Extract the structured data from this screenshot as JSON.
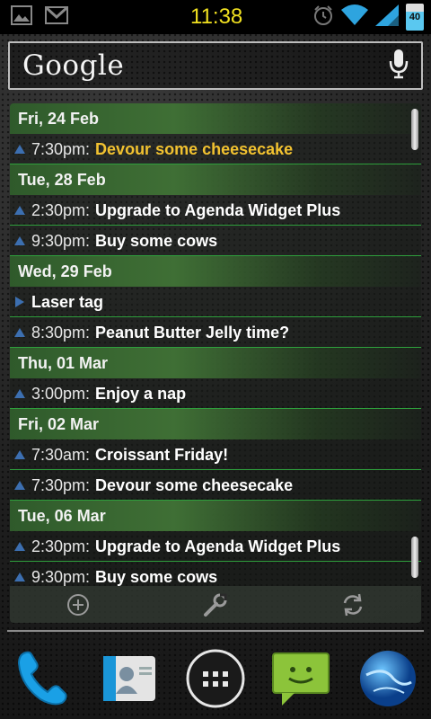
{
  "status_bar": {
    "time": "11:38",
    "battery_level": "40",
    "left_icons": [
      "gallery-icon",
      "gmail-icon"
    ],
    "right_icons": [
      "alarm-icon",
      "wifi-icon",
      "signal-icon",
      "battery-icon"
    ]
  },
  "search": {
    "logo": "Google",
    "mic_icon": "microphone-icon"
  },
  "agenda": {
    "days": [
      {
        "label": "Fri, 24 Feb",
        "events": [
          {
            "time": "7:30pm:",
            "title": "Devour some cheesecake",
            "highlight": true
          }
        ]
      },
      {
        "label": "Tue, 28 Feb",
        "events": [
          {
            "time": "2:30pm:",
            "title": "Upgrade to Agenda Widget Plus"
          },
          {
            "time": "9:30pm:",
            "title": "Buy some cows"
          }
        ]
      },
      {
        "label": "Wed, 29 Feb",
        "events": [
          {
            "time": "",
            "title": "Laser tag",
            "all_day": true
          },
          {
            "time": "8:30pm:",
            "title": "Peanut Butter Jelly time?"
          }
        ]
      },
      {
        "label": "Thu, 01 Mar",
        "events": [
          {
            "time": "3:00pm:",
            "title": "Enjoy a nap"
          }
        ]
      },
      {
        "label": "Fri, 02 Mar",
        "events": [
          {
            "time": "7:30am:",
            "title": "Croissant Friday!"
          },
          {
            "time": "7:30pm:",
            "title": "Devour some cheesecake"
          }
        ]
      },
      {
        "label": "Tue, 06 Mar",
        "events": [
          {
            "time": "2:30pm:",
            "title": "Upgrade to Agenda Widget Plus"
          },
          {
            "time": "9:30pm:",
            "title": "Buy some cows"
          }
        ]
      }
    ],
    "toolbar": [
      "add-icon",
      "settings-wrench-icon",
      "refresh-icon"
    ]
  },
  "dock": [
    "phone-icon",
    "contacts-icon",
    "app-drawer-icon",
    "messaging-icon",
    "browser-icon"
  ],
  "colors": {
    "accent_green": "#2e9f3c",
    "highlight_yellow": "#f2c230",
    "clock_yellow": "#f0e020"
  }
}
